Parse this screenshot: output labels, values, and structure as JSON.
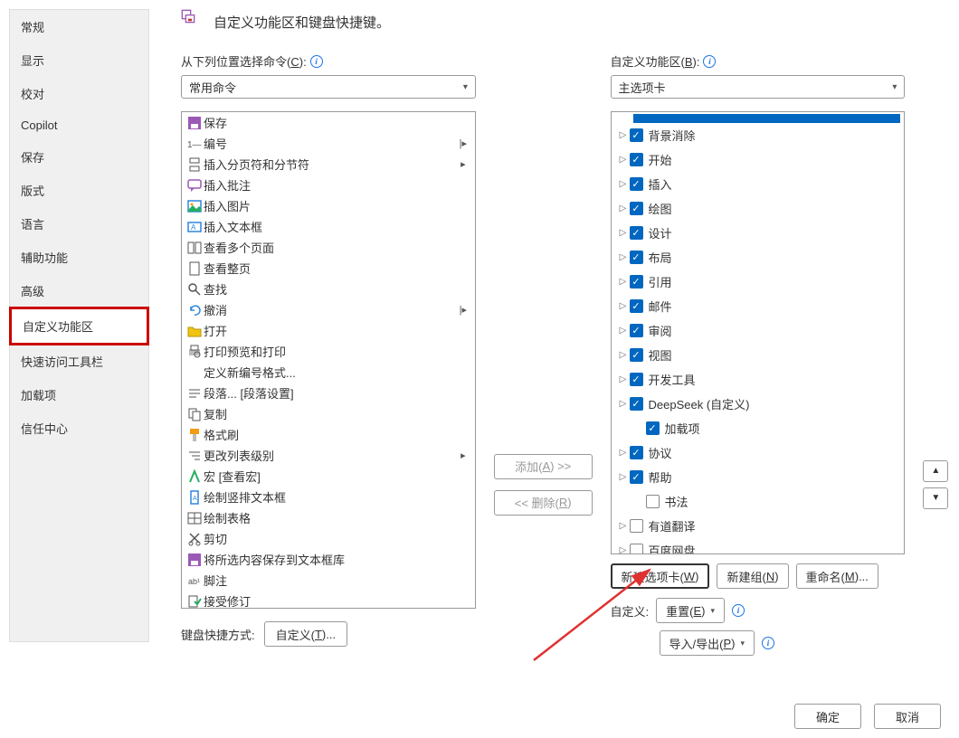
{
  "sidebar": {
    "items": [
      "常规",
      "显示",
      "校对",
      "Copilot",
      "保存",
      "版式",
      "语言",
      "辅助功能",
      "高级",
      "自定义功能区",
      "快速访问工具栏",
      "加载项",
      "信任中心"
    ],
    "highlighted_index": 9
  },
  "header": {
    "title": "自定义功能区和键盘快捷键。"
  },
  "left": {
    "label_prefix": "从下列位置选择命令(",
    "label_key": "C",
    "label_suffix": "):",
    "dropdown": "常用命令",
    "commands": [
      {
        "icon": "save",
        "text": "保存",
        "sub": ""
      },
      {
        "icon": "number",
        "text": "编号",
        "sub": "|▸"
      },
      {
        "icon": "pagebreak",
        "text": "插入分页符和分节符",
        "sub": "▸"
      },
      {
        "icon": "comment",
        "text": "插入批注",
        "sub": ""
      },
      {
        "icon": "image",
        "text": "插入图片",
        "sub": ""
      },
      {
        "icon": "textbox",
        "text": "插入文本框",
        "sub": ""
      },
      {
        "icon": "pages",
        "text": "查看多个页面",
        "sub": ""
      },
      {
        "icon": "page",
        "text": "查看整页",
        "sub": ""
      },
      {
        "icon": "search",
        "text": "查找",
        "sub": ""
      },
      {
        "icon": "undo",
        "text": "撤消",
        "sub": "|▸"
      },
      {
        "icon": "open",
        "text": "打开",
        "sub": ""
      },
      {
        "icon": "printpreview",
        "text": "打印预览和打印",
        "sub": ""
      },
      {
        "icon": "",
        "text": "定义新编号格式...",
        "sub": ""
      },
      {
        "icon": "paragraph",
        "text": "段落... [段落设置]",
        "sub": ""
      },
      {
        "icon": "copy",
        "text": "复制",
        "sub": ""
      },
      {
        "icon": "formatpainter",
        "text": "格式刷",
        "sub": ""
      },
      {
        "icon": "listlevel",
        "text": "更改列表级别",
        "sub": "▸"
      },
      {
        "icon": "macro",
        "text": "宏 [查看宏]",
        "sub": ""
      },
      {
        "icon": "verttext",
        "text": "绘制竖排文本框",
        "sub": ""
      },
      {
        "icon": "table",
        "text": "绘制表格",
        "sub": ""
      },
      {
        "icon": "cut",
        "text": "剪切",
        "sub": ""
      },
      {
        "icon": "saveselection",
        "text": "将所选内容保存到文本框库",
        "sub": ""
      },
      {
        "icon": "footnote",
        "text": "脚注",
        "sub": ""
      },
      {
        "icon": "trackchanges",
        "text": "接受修订",
        "sub": ""
      }
    ],
    "keyboard_label": "键盘快捷方式:",
    "keyboard_btn_prefix": "自定义(",
    "keyboard_btn_key": "T",
    "keyboard_btn_suffix": ")..."
  },
  "mid": {
    "add_prefix": "添加(",
    "add_key": "A",
    "add_suffix": ") >>",
    "remove_prefix": "<< 删除(",
    "remove_key": "R",
    "remove_suffix": ")"
  },
  "right": {
    "label_prefix": "自定义功能区(",
    "label_key": "B",
    "label_suffix": "):",
    "dropdown": "主选项卡",
    "tree": [
      {
        "chev": true,
        "checked": true,
        "label": "背景消除",
        "indent": 0
      },
      {
        "chev": true,
        "checked": true,
        "label": "开始",
        "indent": 0
      },
      {
        "chev": true,
        "checked": true,
        "label": "插入",
        "indent": 0
      },
      {
        "chev": true,
        "checked": true,
        "label": "绘图",
        "indent": 0
      },
      {
        "chev": true,
        "checked": true,
        "label": "设计",
        "indent": 0
      },
      {
        "chev": true,
        "checked": true,
        "label": "布局",
        "indent": 0
      },
      {
        "chev": true,
        "checked": true,
        "label": "引用",
        "indent": 0
      },
      {
        "chev": true,
        "checked": true,
        "label": "邮件",
        "indent": 0
      },
      {
        "chev": true,
        "checked": true,
        "label": "审阅",
        "indent": 0
      },
      {
        "chev": true,
        "checked": true,
        "label": "视图",
        "indent": 0
      },
      {
        "chev": true,
        "checked": true,
        "label": "开发工具",
        "indent": 0
      },
      {
        "chev": true,
        "checked": true,
        "label": "DeepSeek (自定义)",
        "indent": 0
      },
      {
        "chev": false,
        "checked": true,
        "label": "加载项",
        "indent": 1
      },
      {
        "chev": true,
        "checked": true,
        "label": "协议",
        "indent": 0
      },
      {
        "chev": true,
        "checked": true,
        "label": "帮助",
        "indent": 0
      },
      {
        "chev": false,
        "checked": false,
        "label": "书法",
        "indent": 1
      },
      {
        "chev": true,
        "checked": false,
        "label": "有道翻译",
        "indent": 0
      },
      {
        "chev": true,
        "checked": false,
        "label": "百度网盘",
        "indent": 0
      }
    ],
    "new_tab_prefix": "新建选项卡(",
    "new_tab_key": "W",
    "new_tab_suffix": ")",
    "new_group_prefix": "新建组(",
    "new_group_key": "N",
    "new_group_suffix": ")",
    "rename_prefix": "重命名(",
    "rename_key": "M",
    "rename_suffix": ")...",
    "customize_label": "自定义:",
    "reset_prefix": "重置(",
    "reset_key": "E",
    "reset_suffix": ")",
    "import_prefix": "导入/导出(",
    "import_key": "P",
    "import_suffix": ")"
  },
  "footer": {
    "ok": "确定",
    "cancel": "取消"
  }
}
